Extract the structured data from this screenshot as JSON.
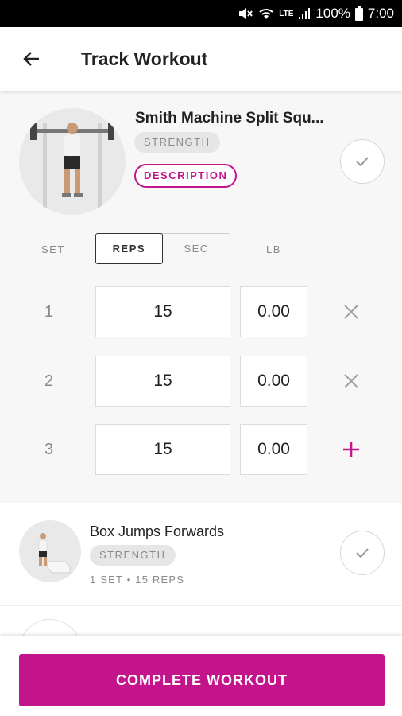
{
  "status_bar": {
    "battery": "100%",
    "time": "7:00",
    "network": "LTE"
  },
  "header": {
    "title": "Track Workout"
  },
  "active_exercise": {
    "name": "Smith Machine Split Squ...",
    "category": "STRENGTH",
    "description_label": "DESCRIPTION",
    "columns": {
      "set": "SET",
      "reps": "REPS",
      "sec": "SEC",
      "weight": "LB"
    },
    "mode_selected": "REPS",
    "sets": [
      {
        "number": "1",
        "reps": "15",
        "weight": "0.00",
        "action": "remove"
      },
      {
        "number": "2",
        "reps": "15",
        "weight": "0.00",
        "action": "remove"
      },
      {
        "number": "3",
        "reps": "15",
        "weight": "0.00",
        "action": "add"
      }
    ]
  },
  "next_exercise": {
    "name": "Box Jumps Forwards",
    "category": "STRENGTH",
    "summary": "1 SET • 15 REPS"
  },
  "footer": {
    "complete_label": "COMPLETE WORKOUT"
  },
  "colors": {
    "accent": "#c4148c",
    "muted": "#8a8a8a",
    "panel_bg": "#f7f7f7"
  }
}
